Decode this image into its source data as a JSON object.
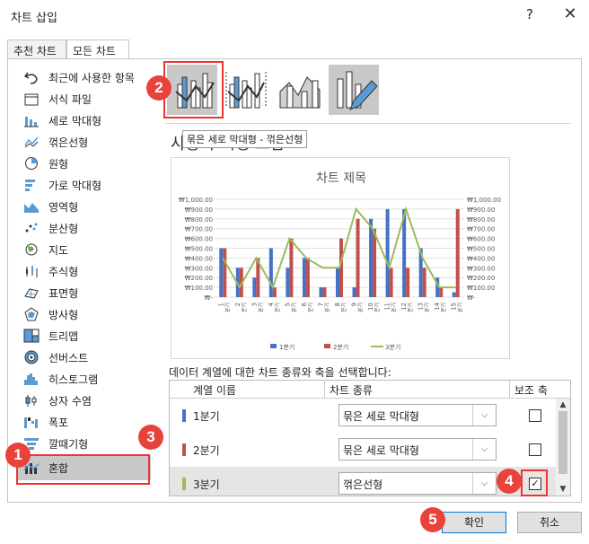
{
  "dialog": {
    "title": "차트 삽입",
    "help": "?",
    "close": "✕"
  },
  "tabs": [
    "추천 차트",
    "모든 차트"
  ],
  "sidebar": {
    "items": [
      {
        "label": "최근에 사용한 항목",
        "icon": "undo-icon"
      },
      {
        "label": "서식 파일",
        "icon": "folder-icon"
      },
      {
        "label": "세로 막대형",
        "icon": "column-chart-icon"
      },
      {
        "label": "꺾은선형",
        "icon": "line-chart-icon"
      },
      {
        "label": "원형",
        "icon": "pie-chart-icon"
      },
      {
        "label": "가로 막대형",
        "icon": "bar-chart-icon"
      },
      {
        "label": "영역형",
        "icon": "area-chart-icon"
      },
      {
        "label": "분산형",
        "icon": "scatter-chart-icon"
      },
      {
        "label": "지도",
        "icon": "map-chart-icon"
      },
      {
        "label": "주식형",
        "icon": "stock-chart-icon"
      },
      {
        "label": "표면형",
        "icon": "surface-chart-icon"
      },
      {
        "label": "방사형",
        "icon": "radar-chart-icon"
      },
      {
        "label": "트리맵",
        "icon": "treemap-chart-icon"
      },
      {
        "label": "선버스트",
        "icon": "sunburst-chart-icon"
      },
      {
        "label": "히스토그램",
        "icon": "histogram-chart-icon"
      },
      {
        "label": "상자 수염",
        "icon": "box-whisker-chart-icon"
      },
      {
        "label": "폭포",
        "icon": "waterfall-chart-icon"
      },
      {
        "label": "깔때기형",
        "icon": "funnel-chart-icon"
      },
      {
        "label": "혼합",
        "icon": "combo-chart-icon"
      }
    ],
    "selected": "혼합"
  },
  "badges": [
    "2",
    "3",
    "1",
    "4",
    "5"
  ],
  "subtype": {
    "heading": "사용자 지정 조합",
    "tooltip": "묶은 세로 막대형 - 꺾은선형"
  },
  "chart_data": {
    "type": "bar",
    "title": "차트 제목",
    "categories": [
      "1",
      "2",
      "3",
      "4",
      "5",
      "6",
      "7",
      "8",
      "9",
      "10",
      "11",
      "12",
      "13",
      "14",
      "15"
    ],
    "category_suffix": "분기",
    "series": [
      {
        "name": "1분기",
        "kind": "bar",
        "color": "#4472c4",
        "values": [
          500,
          300,
          200,
          500,
          300,
          400,
          100,
          300,
          100,
          800,
          900,
          900,
          500,
          200,
          50
        ]
      },
      {
        "name": "2분기",
        "kind": "bar",
        "color": "#c0504d",
        "values": [
          500,
          300,
          400,
          100,
          600,
          400,
          100,
          600,
          800,
          700,
          300,
          300,
          300,
          100,
          900
        ]
      },
      {
        "name": "3분기",
        "kind": "line",
        "color": "#9bbb59",
        "axis": "secondary",
        "values": [
          400,
          100,
          400,
          100,
          600,
          400,
          300,
          300,
          900,
          700,
          300,
          900,
          400,
          100,
          100
        ]
      }
    ],
    "ylim": [
      0,
      1000
    ],
    "y_ticks": [
      "₩-",
      "₩100.00",
      "₩200.00",
      "₩300.00",
      "₩400.00",
      "₩500.00",
      "₩600.00",
      "₩700.00",
      "₩800.00",
      "₩900.00",
      "₩1,000.00"
    ],
    "y2_ticks": [
      "₩-",
      "₩100.00",
      "₩200.00",
      "₩300.00",
      "₩400.00",
      "₩500.00",
      "₩600.00",
      "₩700.00",
      "₩800.00",
      "₩900.00",
      "₩1,000.00"
    ],
    "legend_position": "bottom",
    "grid": true
  },
  "series_table": {
    "instruction": "데이터 계열에 대한 차트 종류와 축을 선택합니다:",
    "headers": [
      "계열 이름",
      "차트 종류",
      "보조 축"
    ],
    "rows": [
      {
        "name": "1분기",
        "color": "#4472c4",
        "chart_type": "묶은 세로 막대형",
        "secondary": false
      },
      {
        "name": "2분기",
        "color": "#c0504d",
        "chart_type": "묶은 세로 막대형",
        "secondary": false
      },
      {
        "name": "3분기",
        "color": "#9bbb59",
        "chart_type": "꺾은선형",
        "secondary": true
      }
    ]
  },
  "buttons": {
    "ok": "확인",
    "cancel": "취소"
  }
}
